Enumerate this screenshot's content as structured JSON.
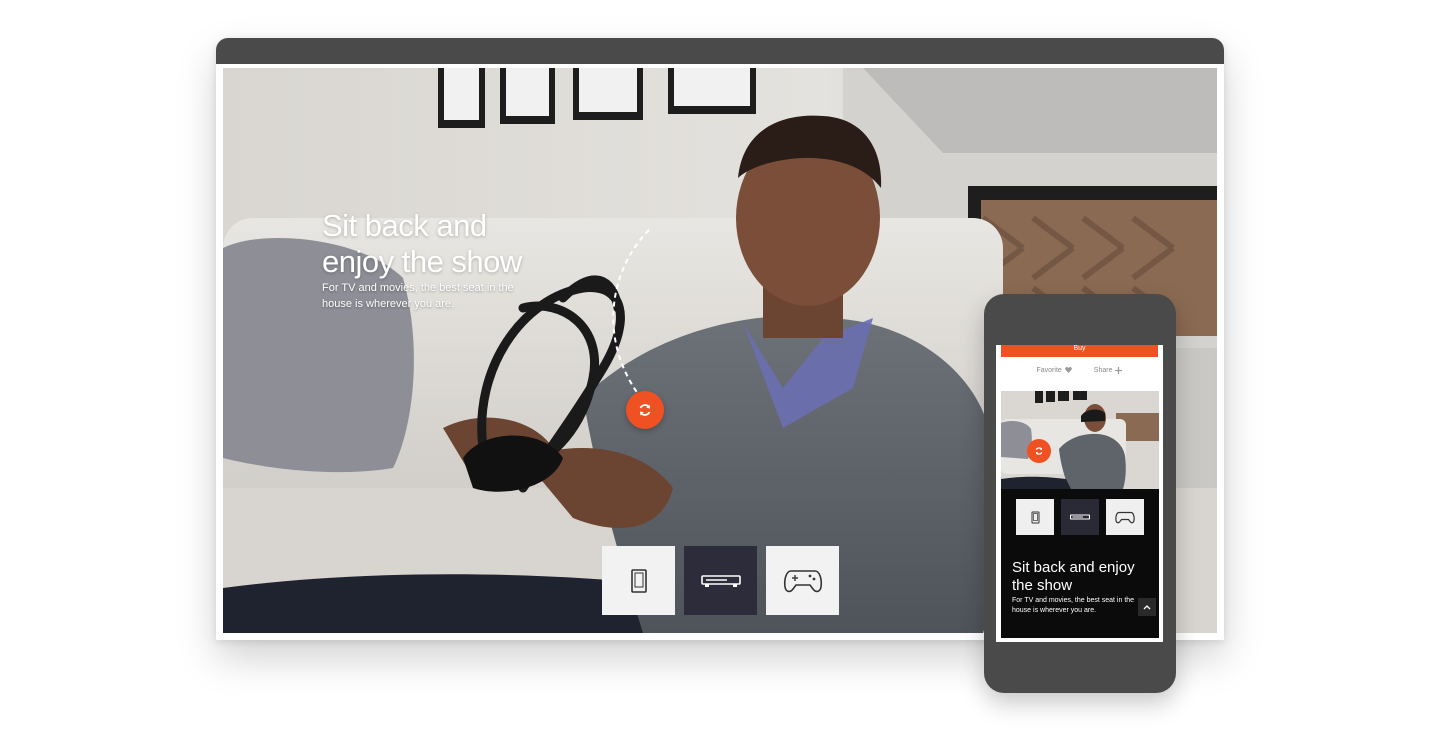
{
  "desktop": {
    "hero": {
      "title": "Sit back and\nenjoy the show",
      "subtitle": "For TV and movies, the best seat in the house is wherever you are."
    },
    "device_tiles": [
      {
        "icon": "tablet-icon",
        "active": false
      },
      {
        "icon": "console-icon",
        "active": true
      },
      {
        "icon": "gamepad-icon",
        "active": false
      }
    ]
  },
  "phone": {
    "buy_label": "Buy",
    "actions": {
      "favorite": "Favorite",
      "share": "Share"
    },
    "title": "Sit back and enjoy\nthe show",
    "subtitle": "For TV and movies, the best seat in the house is wherever you are."
  },
  "colors": {
    "accent": "#f05123",
    "frame": "#4a4a4a",
    "active_tile": "#2c2c3a"
  }
}
